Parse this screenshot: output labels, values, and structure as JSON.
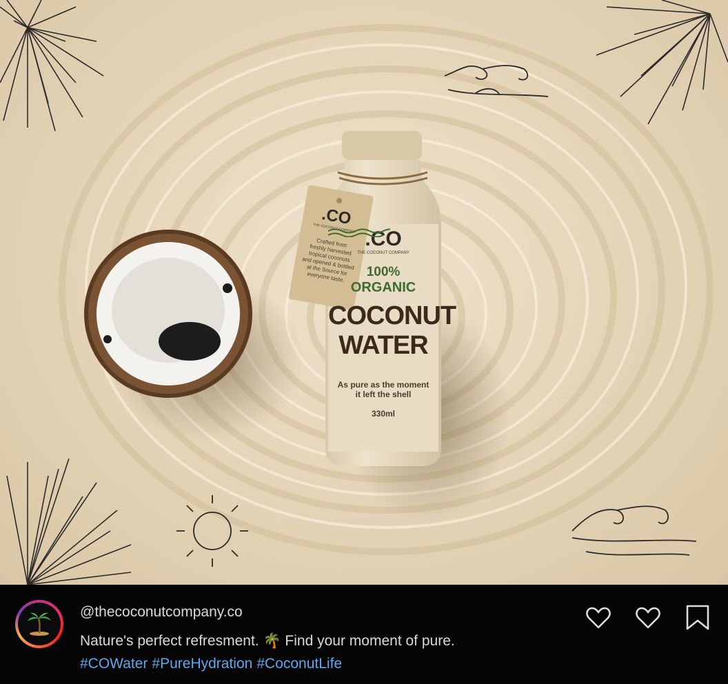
{
  "post": {
    "username": "@thecoconutcompany.co",
    "caption": "Nature's perfect refresment. 🌴 Find your moment of pure.",
    "hashtags": [
      "#COWater",
      "#PureHydration",
      "#CoconutLife"
    ]
  },
  "avatar": {
    "icon": "palm-tree-island-icon"
  },
  "actions": {
    "like_icon": "heart-outline-icon",
    "like2_icon": "heart-outline-icon",
    "save_icon": "bookmark-outline-icon"
  },
  "product": {
    "brand": ".CO",
    "brand_sub": "THE COCONUT COMPANY",
    "organic": "100%\nORGANIC",
    "organic_line1": "100%",
    "organic_line2": "ORGANIC",
    "name_line1": "COCONUT",
    "name_line2": "WATER",
    "tagline_line1": "As pure as the moment",
    "tagline_line2": "it left the shell",
    "volume": "330ml"
  },
  "tag": {
    "brand": ".CO",
    "brand_sub": "THE COCONUT COMPANY",
    "lines": [
      "Crafted from",
      "freshly harvested",
      "tropical coconuts",
      "and opened & bottled",
      "at the Source for",
      "everyone taste."
    ]
  },
  "colors": {
    "sand": "#e6d6ba",
    "bottle": "#e9dcc3",
    "accent_green": "#3e6b2e",
    "text_brown": "#3a2a1c",
    "link": "#5aa8f0"
  }
}
